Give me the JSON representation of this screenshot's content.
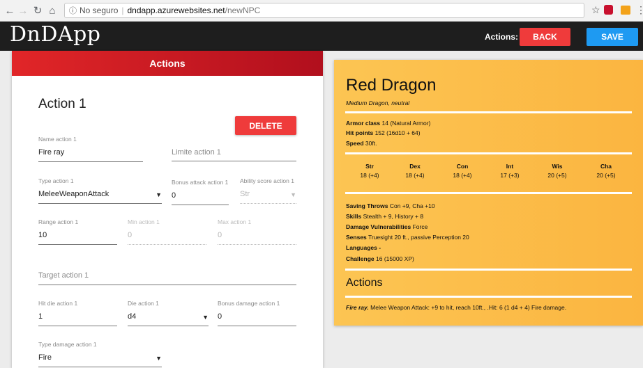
{
  "browser": {
    "security_label": "No seguro",
    "host": "dndapp.azurewebsites.net",
    "path": "/newNPC"
  },
  "app": {
    "logo": "DnDApp",
    "actions_label": "Actions:",
    "back_label": "BACK",
    "save_label": "SAVE"
  },
  "form": {
    "header": "Actions",
    "action_title": "Action 1",
    "delete_label": "DELETE",
    "name": {
      "label": "Name action 1",
      "value": "Fire ray"
    },
    "limite": {
      "placeholder": "Limite action 1"
    },
    "type": {
      "label": "Type action 1",
      "value": "MeleeWeaponAttack"
    },
    "bonus_attack": {
      "label": "Bonus attack action 1",
      "value": "0"
    },
    "ability_score": {
      "label": "Ability score action 1",
      "value": "Str"
    },
    "range": {
      "label": "Range action 1",
      "value": "10"
    },
    "min": {
      "label": "Min action 1",
      "value": "0"
    },
    "max": {
      "label": "Max action 1",
      "value": "0"
    },
    "target": {
      "placeholder": "Target action 1"
    },
    "hit_die": {
      "label": "Hit die action 1",
      "value": "1"
    },
    "die": {
      "label": "Die action 1",
      "value": "d4"
    },
    "bonus_damage": {
      "label": "Bonus damage action 1",
      "value": "0"
    },
    "type_damage": {
      "label": "Type damage action 1",
      "value": "Fire"
    }
  },
  "card": {
    "name": "Red Dragon",
    "subtitle": "Medium Dragon, neutral",
    "armor_label": "Armor class",
    "armor_value": "14 (Natural Armor)",
    "hp_label": "Hit points",
    "hp_value": "152 (16d10 + 64)",
    "speed_label": "Speed",
    "speed_value": "30ft.",
    "stats": [
      {
        "name": "Str",
        "value": "18 (+4)"
      },
      {
        "name": "Dex",
        "value": "18 (+4)"
      },
      {
        "name": "Con",
        "value": "18 (+4)"
      },
      {
        "name": "Int",
        "value": "17 (+3)"
      },
      {
        "name": "Wis",
        "value": "20 (+5)"
      },
      {
        "name": "Cha",
        "value": "20 (+5)"
      }
    ],
    "saving_label": "Saving Throws",
    "saving_value": "Con +9, Cha +10",
    "skills_label": "Skills",
    "skills_value": "Stealth + 9, History + 8",
    "vuln_label": "Damage Vulnerabilities",
    "vuln_value": "Force",
    "senses_label": "Senses",
    "senses_value": "Truesight 20 ft., passive Perception 20",
    "languages_label": "Languages",
    "languages_value": "-",
    "challenge_label": "Challenge",
    "challenge_value": "16 (15000 XP)",
    "actions_title": "Actions",
    "action_name": "Fire ray.",
    "action_text": "Melee Weapon Attack: +9 to hit, reach 10ft., .Hit: 6 (1 d4 + 4) Fire damage."
  }
}
